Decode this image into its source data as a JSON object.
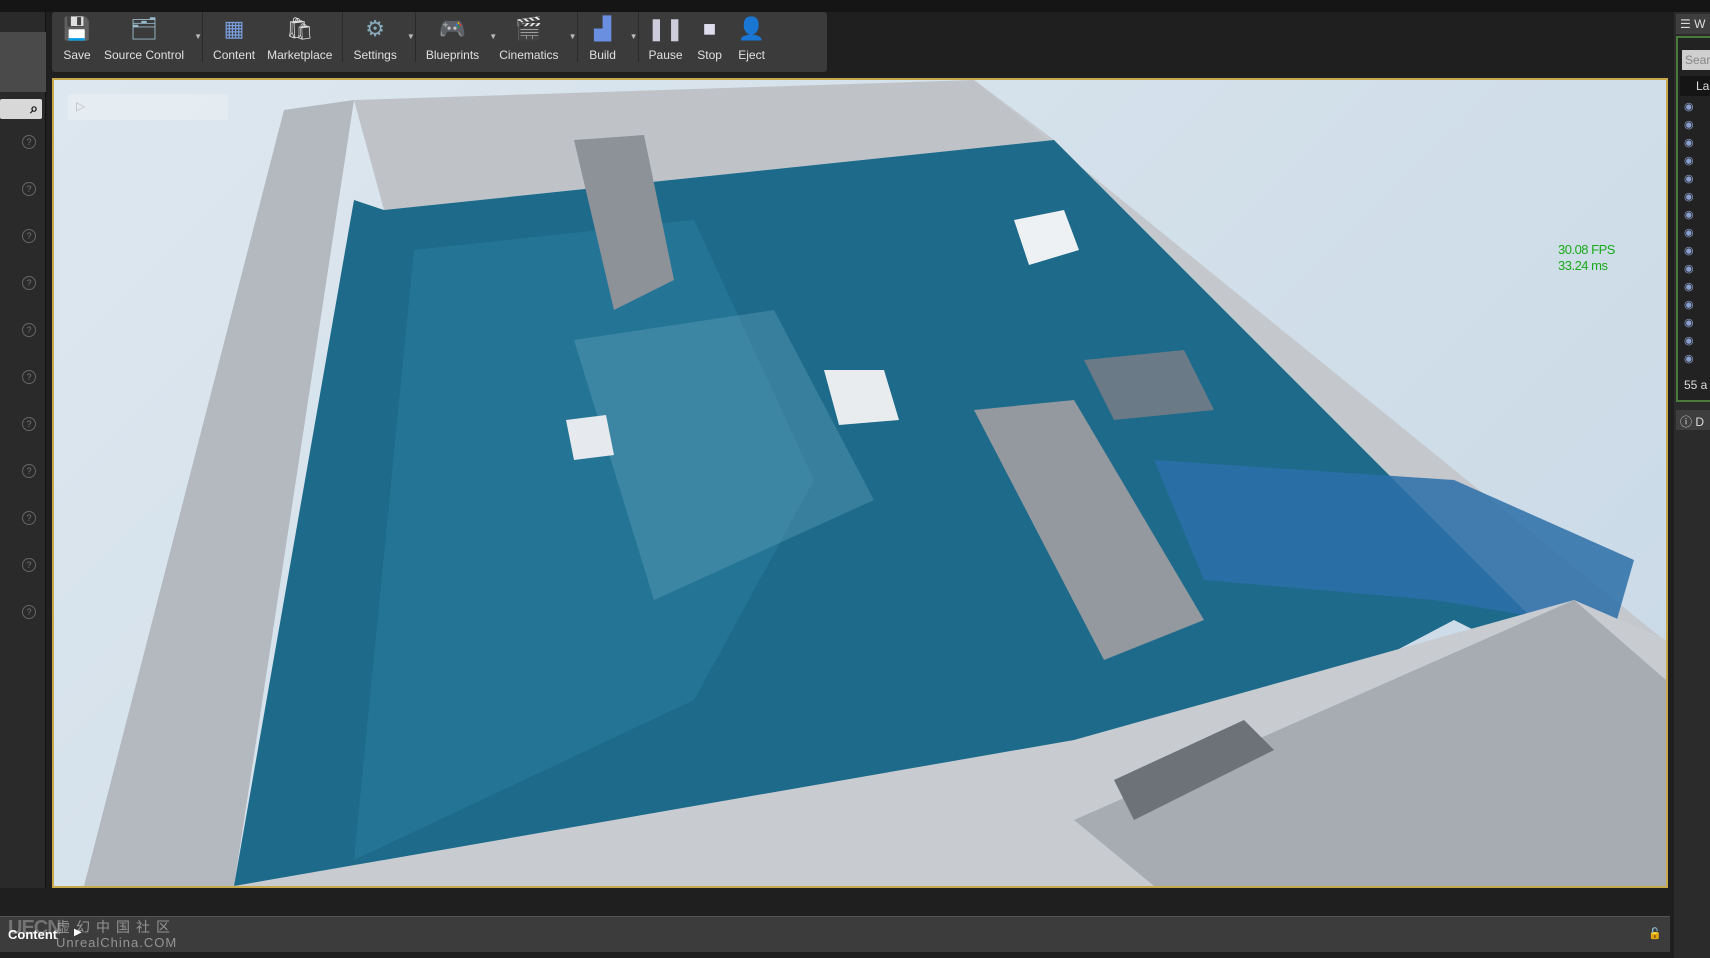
{
  "toolbar": {
    "items": [
      {
        "label": "Save",
        "icon": "floppy-disk-icon",
        "dropdown": false
      },
      {
        "label": "Source Control",
        "icon": "source-control-icon",
        "dropdown": true
      },
      {
        "label": "Content",
        "icon": "content-grid-icon",
        "dropdown": false
      },
      {
        "label": "Marketplace",
        "icon": "marketplace-bag-icon",
        "dropdown": false
      },
      {
        "label": "Settings",
        "icon": "gear-icon",
        "dropdown": true
      },
      {
        "label": "Blueprints",
        "icon": "blueprint-gamepad-icon",
        "dropdown": true
      },
      {
        "label": "Cinematics",
        "icon": "clapperboard-icon",
        "dropdown": true
      },
      {
        "label": "Build",
        "icon": "build-blocks-icon",
        "dropdown": true
      },
      {
        "label": "Pause",
        "icon": "pause-icon",
        "dropdown": false
      },
      {
        "label": "Stop",
        "icon": "stop-icon",
        "dropdown": false
      },
      {
        "label": "Eject",
        "icon": "eject-person-icon",
        "dropdown": false
      }
    ]
  },
  "viewport": {
    "stats": {
      "fps": "30.08 FPS",
      "ms": "33.24 ms"
    }
  },
  "outliner": {
    "tab": "W",
    "search_placeholder": "Sear",
    "column": "La",
    "count": "55 a",
    "details_tab": "D"
  },
  "content_browser": {
    "label": "Content"
  },
  "watermark": {
    "logo": "UECN",
    "cn": "虚幻中国社区",
    "en": "UnrealChina.COM"
  },
  "colors": {
    "viewport_border": "#c8a84c",
    "fps": "#1aaa1a",
    "water": "#1d6a8a"
  }
}
